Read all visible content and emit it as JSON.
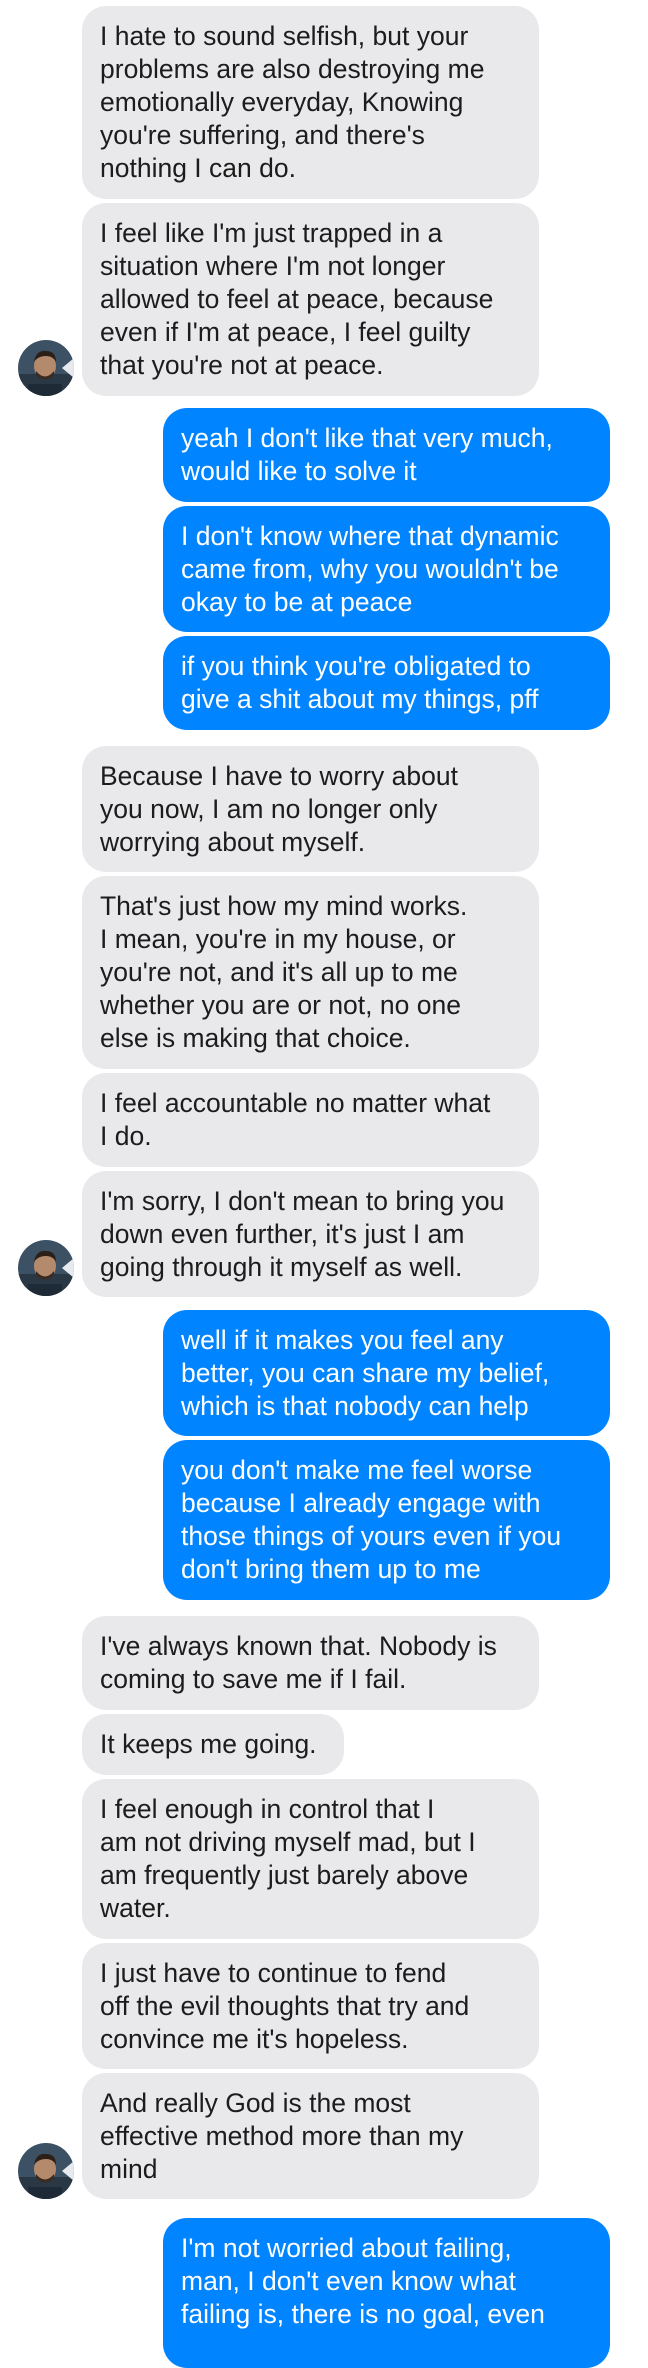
{
  "messages": [
    {
      "dir": "in",
      "text": "I hate to sound selfish, but your\nproblems are also destroying me\nemotionally everyday, Knowing\nyou're suffering, and there's\nnothing I can do."
    },
    {
      "dir": "in",
      "text": "I feel like I'm just trapped in a\nsituation where I'm not longer\nallowed to feel at peace, because\neven if I'm at peace, I feel guilty\nthat you're not at peace.",
      "avatar": true
    },
    {
      "dir": "out",
      "text": "yeah I don't like that very much,\nwould like to solve it"
    },
    {
      "dir": "out",
      "text": "I don't know where that dynamic\ncame from, why you wouldn't be\nokay to be at peace"
    },
    {
      "dir": "out",
      "text": "if you think you're obligated to\ngive a shit about my things, pff"
    },
    {
      "dir": "in",
      "text": "Because I have to worry about\nyou now, I am no longer only\nworrying about myself."
    },
    {
      "dir": "in",
      "text": "That's just how my mind works.\nI mean, you're in my house, or\nyou're not, and it's all up to me\nwhether you are or not, no one\nelse is making that choice."
    },
    {
      "dir": "in",
      "text": "I feel accountable no matter what\nI do."
    },
    {
      "dir": "in",
      "text": "I'm sorry, I don't mean to bring you\ndown even further, it's just I am\ngoing through it myself as well.",
      "avatar": true
    },
    {
      "dir": "out",
      "text": "well if it makes you feel any\nbetter, you can share my belief,\nwhich is that nobody can help"
    },
    {
      "dir": "out",
      "text": "you don't make me feel worse\nbecause I already engage with\nthose things of yours even if you\ndon't bring them up to me"
    },
    {
      "dir": "in",
      "text": "I've always known that. Nobody is\ncoming to save me if I fail."
    },
    {
      "dir": "in",
      "text": "It keeps me going."
    },
    {
      "dir": "in",
      "text": "I feel enough in control that I\nam not driving myself mad, but I\nam frequently just barely above\nwater."
    },
    {
      "dir": "in",
      "text": "I just have to continue to fend\noff the evil thoughts that try and\nconvince me it's hopeless."
    },
    {
      "dir": "in",
      "text": "And really God is the most\neffective method more than my\nmind",
      "avatar": true
    },
    {
      "dir": "out",
      "text": "I'm not worried about failing,\nman, I don't even know what\nfailing is, there is no goal, even"
    }
  ]
}
